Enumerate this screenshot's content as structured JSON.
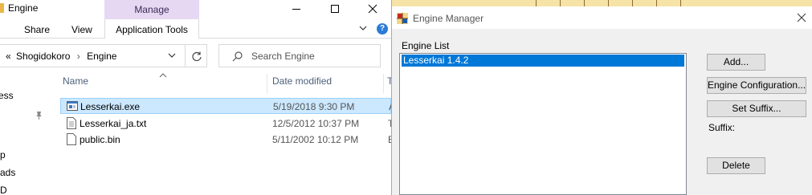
{
  "explorer": {
    "title": "Engine",
    "context_tab": "Manage",
    "ribbon_tabs": [
      "Share",
      "View"
    ],
    "context_subtab": "Application Tools",
    "address": {
      "prefix": "«",
      "crumbs": [
        "Shogidokoro",
        "Engine"
      ]
    },
    "search_placeholder": "Search Engine",
    "nav_items": [
      "ess",
      "p",
      "ads",
      "D"
    ],
    "columns": {
      "name": "Name",
      "date_modified": "Date modified",
      "type_cut": "T"
    },
    "files": [
      {
        "name": "Lesserkai.exe",
        "date": "5/19/2018 9:30 PM",
        "type_cut": "A",
        "icon": "exe-icon",
        "selected": true
      },
      {
        "name": "Lesserkai_ja.txt",
        "date": "12/5/2012 10:37 PM",
        "type_cut": "T",
        "icon": "txt-file-icon",
        "selected": false
      },
      {
        "name": "public.bin",
        "date": "5/11/2002 10:12 PM",
        "type_cut": "B",
        "icon": "file-icon",
        "selected": false
      }
    ]
  },
  "dialog": {
    "title": "Engine Manager",
    "group_label": "Engine List",
    "engines": [
      "Lesserkai 1.4.2"
    ],
    "buttons": {
      "add": "Add...",
      "config": "Engine Configuration...",
      "suffix": "Set Suffix...",
      "delete": "Delete"
    },
    "suffix_label": "Suffix:",
    "colors": {
      "selection": "#0078d7",
      "manage_tab": "#e6d8f3"
    }
  }
}
